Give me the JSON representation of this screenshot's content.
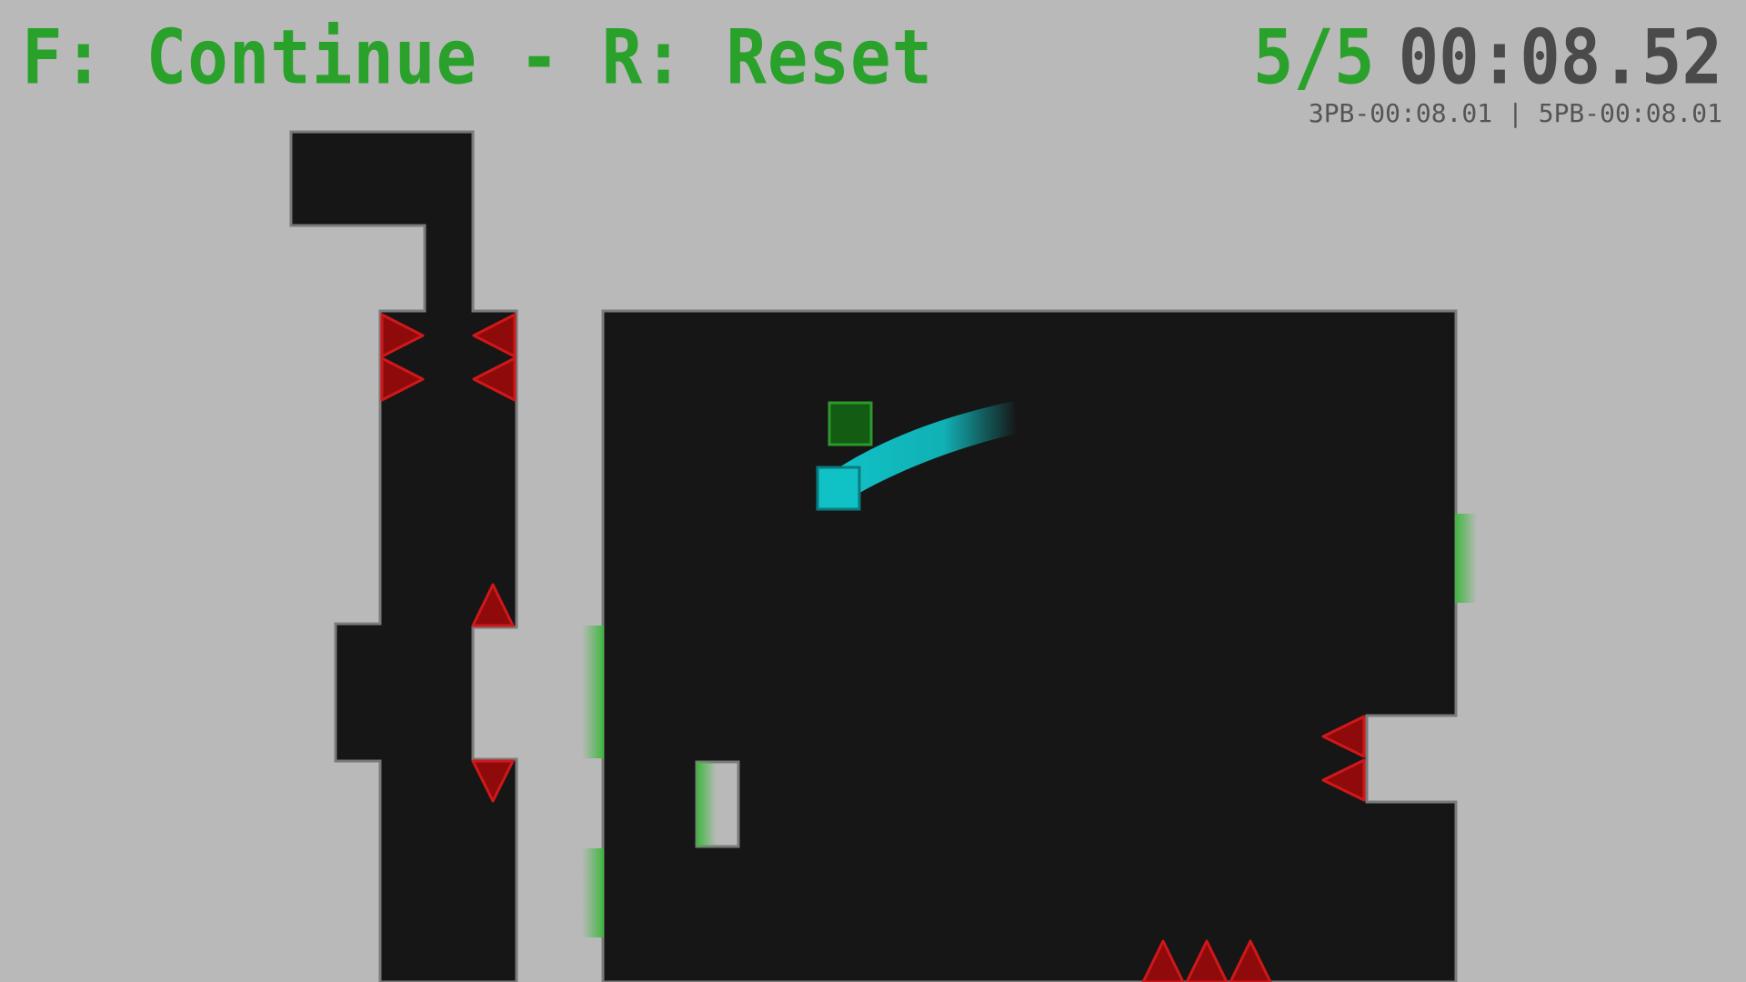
{
  "hud": {
    "controls_hint": "F: Continue - R: Reset",
    "level_counter": "5/5",
    "timer": "00:08.52",
    "personal_bests": "3PB-00:08.01 | 5PB-00:08.01"
  },
  "colors": {
    "background": "#b9b9b9",
    "wall": "#161616",
    "wall_edge": "#7a7a7a",
    "spike": "#8f0b0b",
    "spike_edge": "#d0171a",
    "player": "#10c2c6",
    "goal": "#135c13",
    "hud_green": "#2aa12a",
    "hud_grey": "#4a4a4a"
  },
  "objects": {
    "player": "player-cube",
    "goal": "goal-block",
    "trail": "motion-trail"
  }
}
